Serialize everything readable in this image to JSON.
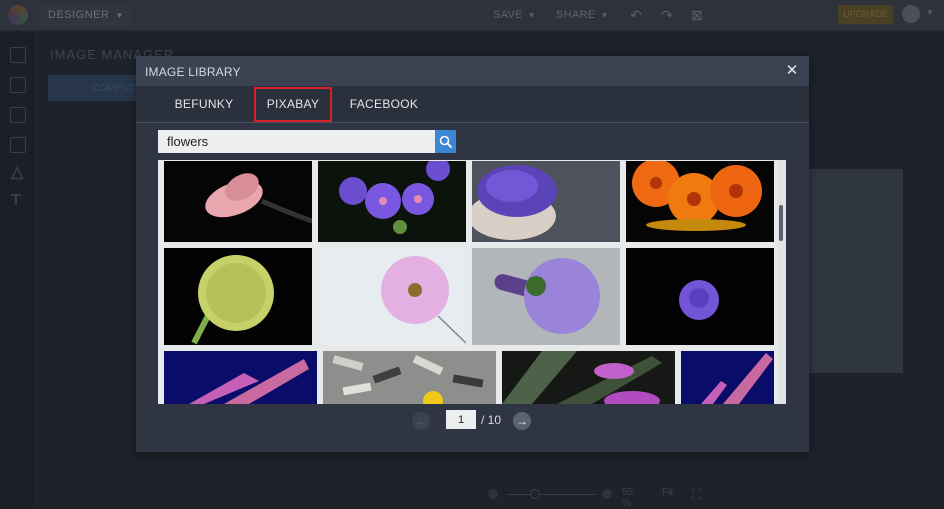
{
  "topbar": {
    "mode_label": "DESIGNER",
    "save_label": "SAVE",
    "share_label": "SHARE",
    "upgrade_label": "UPGRADE",
    "icons": [
      "undo-icon",
      "redo-icon",
      "close-project-icon",
      "avatar-icon"
    ]
  },
  "sidebar": {
    "icons": [
      "image-manager-icon",
      "layers-icon",
      "collage-icon",
      "grid-icon",
      "shapes-icon",
      "text-icon"
    ]
  },
  "panel": {
    "title": "IMAGE MANAGER",
    "button_label": "COMPUTER"
  },
  "zoombar": {
    "zoom_value": "55 %",
    "fit_label": "Fit",
    "zoom_fraction": 0.3
  },
  "modal": {
    "title": "IMAGE LIBRARY",
    "close_icon": "close-icon",
    "tabs": [
      {
        "label": "BEFUNKY",
        "active": false
      },
      {
        "label": "PIXABAY",
        "active": true
      },
      {
        "label": "FACEBOOK",
        "active": false
      }
    ],
    "search": {
      "value": "flowers",
      "placeholder": "Search",
      "button_icon": "search-icon"
    },
    "gallery": {
      "images": [
        {
          "name": "pink-tulip"
        },
        {
          "name": "purple-geranium"
        },
        {
          "name": "hyacinth-bowl"
        },
        {
          "name": "orange-gerbera"
        },
        {
          "name": "allium-bud"
        },
        {
          "name": "pink-cosmos"
        },
        {
          "name": "purple-bouquet"
        },
        {
          "name": "purple-aster"
        },
        {
          "name": "celosia-blue"
        },
        {
          "name": "sunflower-seeds"
        },
        {
          "name": "purple-tulip"
        },
        {
          "name": "celosia-blue-2"
        }
      ],
      "scroll_position": 0.2
    },
    "pagination": {
      "current_page": "1",
      "total_label": "/ 10",
      "prev_icon": "arrow-left-icon",
      "next_icon": "arrow-right-icon"
    }
  },
  "colors": {
    "accent_blue": "#3b87d4",
    "highlight_red": "#d8202a",
    "modal_bg": "#2f3542",
    "modal_header": "#3b4252"
  }
}
